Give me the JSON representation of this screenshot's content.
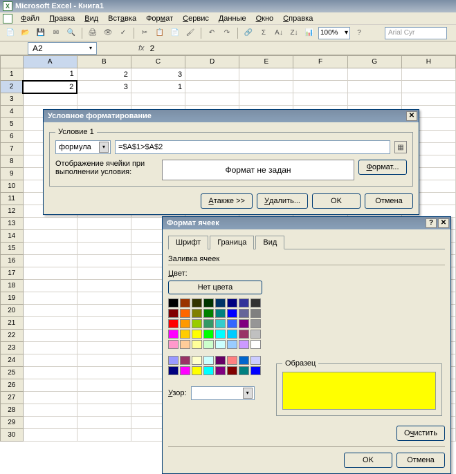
{
  "app": {
    "title": "Microsoft Excel - Книга1"
  },
  "menu": {
    "file": "Файл",
    "edit": "Правка",
    "view": "Вид",
    "insert": "Вставка",
    "format": "Формат",
    "tools": "Сервис",
    "data": "Данные",
    "window": "Окно",
    "help": "Справка"
  },
  "toolbar": {
    "zoom": "100%",
    "font": "Arial Cyr"
  },
  "namebox": "A2",
  "fx": {
    "label": "fx",
    "value": "2"
  },
  "cols": [
    "A",
    "B",
    "C",
    "D",
    "E",
    "F",
    "G",
    "H"
  ],
  "rows": [
    "1",
    "2",
    "3",
    "4",
    "5",
    "6",
    "7",
    "8",
    "9",
    "10",
    "11",
    "12",
    "13",
    "14",
    "15",
    "16",
    "17",
    "18",
    "19",
    "20",
    "21",
    "22",
    "23",
    "24",
    "25",
    "26",
    "27",
    "28",
    "29",
    "30"
  ],
  "cells": {
    "A1": "1",
    "B1": "2",
    "C1": "3",
    "A2": "2",
    "B2": "3",
    "C2": "1"
  },
  "dlg1": {
    "title": "Условное форматирование",
    "cond_legend": "Условие 1",
    "type": "формула",
    "formula": "=$A$1>$A$2",
    "preview_label1": "Отображение ячейки при",
    "preview_label2": "выполнении условия:",
    "preview_text": "Формат не задан",
    "format_btn": "Формат...",
    "also": "А также >>",
    "delete": "Удалить...",
    "ok": "OK",
    "cancel": "Отмена"
  },
  "dlg2": {
    "title": "Формат ячеек",
    "tab_font": "Шрифт",
    "tab_border": "Граница",
    "tab_fill": "Вид",
    "fill_label": "Заливка ячеек",
    "color_label": "Цвет:",
    "nocolor": "Нет цвета",
    "sample": "Образец",
    "pattern": "Узор:",
    "clear": "Очистить",
    "ok": "OK",
    "cancel": "Отмена"
  },
  "palette_main": [
    "#000000",
    "#993300",
    "#333300",
    "#003300",
    "#003366",
    "#000080",
    "#333399",
    "#333333",
    "#800000",
    "#ff6600",
    "#808000",
    "#008000",
    "#008080",
    "#0000ff",
    "#666699",
    "#808080",
    "#ff0000",
    "#ff9900",
    "#99cc00",
    "#339966",
    "#33cccc",
    "#3366ff",
    "#800080",
    "#969696",
    "#ff00ff",
    "#ffcc00",
    "#ffff00",
    "#00ff00",
    "#00ffff",
    "#00ccff",
    "#993366",
    "#c0c0c0",
    "#ff99cc",
    "#ffcc99",
    "#ffff99",
    "#ccffcc",
    "#ccffff",
    "#99ccff",
    "#cc99ff",
    "#ffffff"
  ],
  "palette_extra": [
    "#9999ff",
    "#993366",
    "#ffffcc",
    "#ccffff",
    "#660066",
    "#ff8080",
    "#0066cc",
    "#ccccff",
    "#000080",
    "#ff00ff",
    "#ffff00",
    "#00ffff",
    "#800080",
    "#800000",
    "#008080",
    "#0000ff"
  ],
  "preview_color": "#ffff00"
}
